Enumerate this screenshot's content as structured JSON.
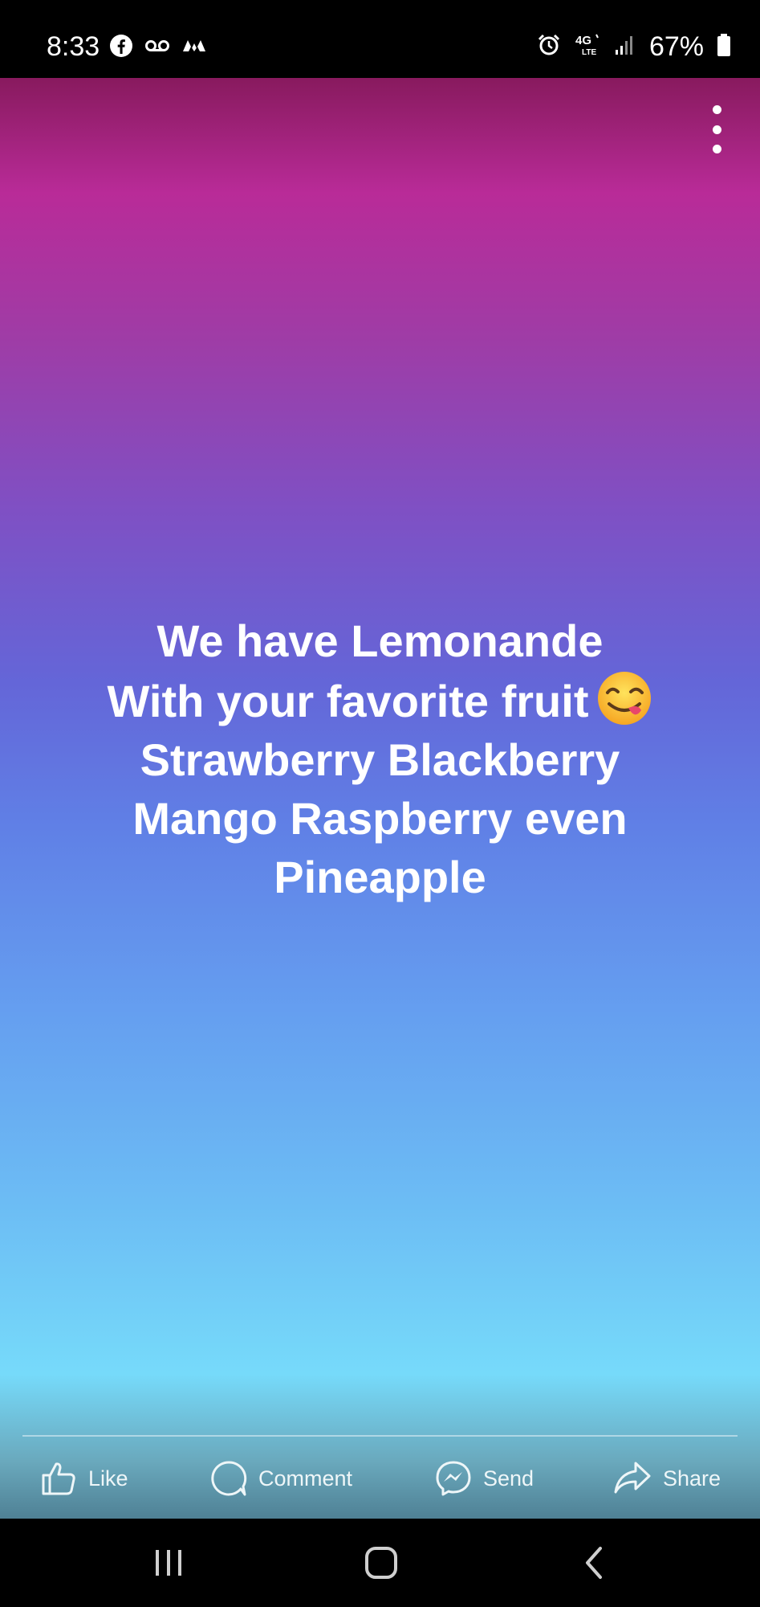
{
  "status_bar": {
    "time": "8:33",
    "left_icons": [
      "facebook-icon",
      "voicemail-icon",
      "app-notification-icon"
    ],
    "right_icons": [
      "alarm-icon",
      "4g-lte-icon",
      "signal-icon",
      "battery-icon"
    ],
    "network_label": "4G",
    "network_sub_label": "LTE",
    "battery_percent": "67%"
  },
  "post": {
    "text_lines": [
      "We have Lemonande",
      "With your favorite fruit",
      "Strawberry Blackberry",
      "Mango Raspberry even",
      "Pineapple"
    ],
    "emoji": "savoring-food-emoji-icon",
    "more_options_icon": "more-vertical-icon"
  },
  "actions": [
    {
      "label": "Like",
      "icon": "thumbs-up-icon"
    },
    {
      "label": "Comment",
      "icon": "comment-icon"
    },
    {
      "label": "Send",
      "icon": "messenger-icon"
    },
    {
      "label": "Share",
      "icon": "share-icon"
    }
  ],
  "nav_bar": {
    "buttons": [
      "recent-apps-icon",
      "home-icon",
      "back-icon"
    ]
  },
  "colors": {
    "gradient_top": "#881a5e",
    "gradient_magenta": "#b92b98",
    "gradient_mid": "#6466d8",
    "gradient_bottom": "#76dafa",
    "action_bar": "#5b8ea2"
  }
}
